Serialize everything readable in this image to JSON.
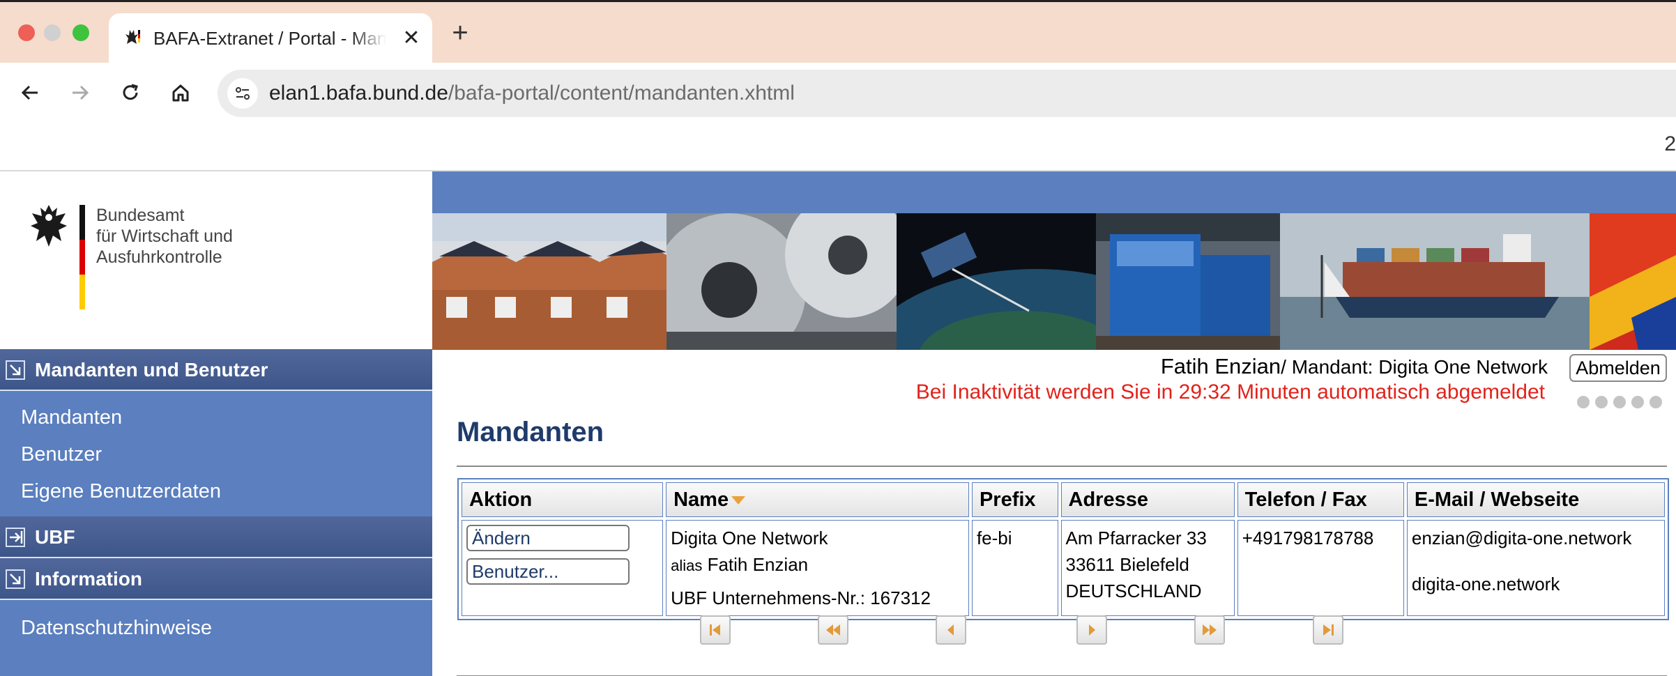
{
  "browser": {
    "tab_title": "BAFA-Extranet / Portal - Mandanten",
    "new_tab_label": "+",
    "close_label": "✕",
    "url_host": "elan1.bafa.bund.de",
    "url_path": "/bafa-portal/content/mandanten.xhtml",
    "bookmark_edge": "2"
  },
  "logo": {
    "line1": "Bundesamt",
    "line2": "für Wirtschaft und",
    "line3": "Ausfuhrkontrolle"
  },
  "sidebar": {
    "sections": [
      {
        "label": "Mandanten und Benutzer",
        "icon": "collapse-icon",
        "items": [
          "Mandanten",
          "Benutzer",
          "Eigene Benutzerdaten"
        ]
      },
      {
        "label": "UBF",
        "icon": "expand-icon",
        "items": []
      },
      {
        "label": "Information",
        "icon": "collapse-icon",
        "items": [
          "Datenschutzhinweise"
        ]
      }
    ]
  },
  "header": {
    "user_name": "Fatih Enzian",
    "mandant_text": "/ Mandant: Digita One Network",
    "logout_label": "Abmelden",
    "inactivity_notice": "Bei Inaktivität werden Sie in 29:32 Minuten automatisch abgemeldet"
  },
  "main": {
    "title": "Mandanten",
    "table": {
      "headers": [
        "Aktion",
        "Name",
        "Prefix",
        "Adresse",
        "Telefon / Fax",
        "E-Mail / Webseite"
      ],
      "rows": [
        {
          "actions": [
            "Ändern",
            "Benutzer..."
          ],
          "name": "Digita One Network",
          "alias_prefix": "alias",
          "alias_name": "Fatih Enzian",
          "ubf": "UBF Unternehmens-Nr.: 167312",
          "prefix": "fe-bi",
          "address": [
            "Am Pfarracker 33",
            "33611 Bielefeld",
            "DEUTSCHLAND"
          ],
          "phone": "+491798178788",
          "email": "enzian@digita-one.network",
          "website": "digita-one.network"
        }
      ]
    },
    "pager": [
      "first-page-icon",
      "fast-rewind-icon",
      "previous-page-icon",
      "next-page-icon",
      "fast-forward-icon",
      "last-page-icon"
    ]
  },
  "colors": {
    "sidebar_bg": "#5b7fbf",
    "sidebar_header": "#3d5689",
    "title": "#1f3b6b",
    "warning": "#e2221b"
  }
}
